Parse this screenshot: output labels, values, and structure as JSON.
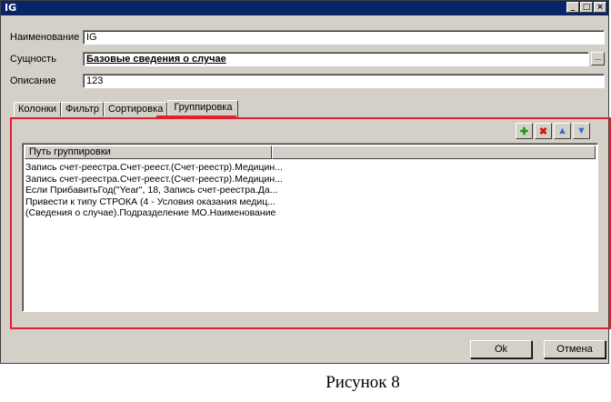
{
  "window": {
    "title": "IG",
    "controls": {
      "minimize": "_",
      "maximize": "□",
      "close": "×"
    }
  },
  "form": {
    "name_label": "Наименование",
    "name_value": "IG",
    "entity_label": "Сущность",
    "entity_value": "Базовые сведения о случае",
    "entity_browse": "...",
    "description_label": "Описание",
    "description_value": "123"
  },
  "tabs": [
    {
      "label": "Колонки"
    },
    {
      "label": "Фильтр"
    },
    {
      "label": "Сортировка"
    },
    {
      "label": "Группировка",
      "active": true
    }
  ],
  "toolbar": {
    "add_icon": "plus-icon",
    "delete_icon": "delete-icon",
    "up_icon": "arrow-up-icon",
    "down_icon": "arrow-down-icon"
  },
  "grouping_list": {
    "columns": [
      "Путь группировки",
      ""
    ],
    "rows": [
      "Запись счет-реестра.Счет-реест.(Счет-реестр).Медицин...",
      "Запись счет-реестра.Счет-реест.(Счет-реестр).Медицин...",
      "Если ПрибавитьГод(\"Year\", 18, Запись счет-реестра.Да...",
      "Привести к типу СТРОКА (4 - Условия оказания медиц...",
      "(Сведения о случае).Подразделение МО.Наименование"
    ]
  },
  "buttons": {
    "ok": "Ok",
    "cancel": "Отмена"
  },
  "caption": "Рисунок 8",
  "colors": {
    "titlebar": "#0a246a",
    "highlight": "#e0202a",
    "face": "#d4d0c8"
  }
}
